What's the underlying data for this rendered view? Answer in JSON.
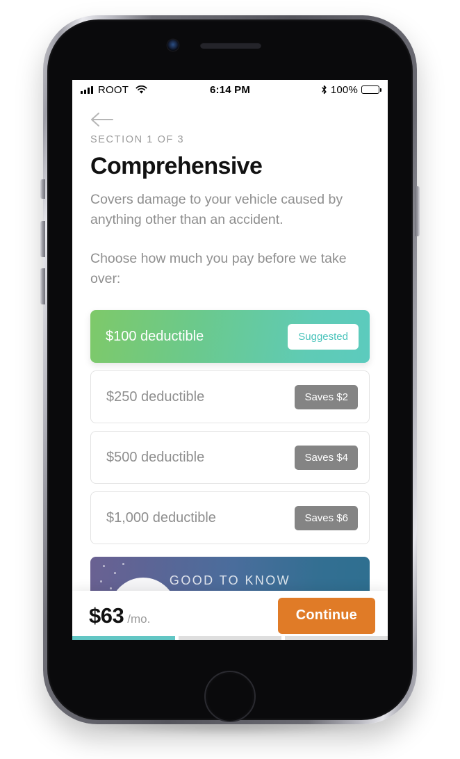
{
  "statusbar": {
    "carrier": "ROOT",
    "signal_icon": "cellular-signal-icon",
    "wifi_icon": "wifi-icon",
    "time": "6:14 PM",
    "bluetooth_icon": "bluetooth-icon",
    "battery_percent": "100%",
    "battery_icon": "battery-full-icon"
  },
  "nav": {
    "back_icon": "back-arrow-icon"
  },
  "header": {
    "eyebrow": "SECTION 1 OF 3",
    "title": "Comprehensive",
    "description": "Covers damage to your vehicle caused by anything other than an accident.",
    "prompt": "Choose how much you pay before we take over:"
  },
  "options": [
    {
      "label": "$100 deductible",
      "badge": "Suggested",
      "selected": true
    },
    {
      "label": "$250 deductible",
      "badge": "Saves $2",
      "selected": false
    },
    {
      "label": "$500 deductible",
      "badge": "Saves $4",
      "selected": false
    },
    {
      "label": "$1,000 deductible",
      "badge": "Saves $6",
      "selected": false
    }
  ],
  "good_to_know": {
    "label": "GOOD TO KNOW",
    "moon_icon": "moon-icon"
  },
  "bottombar": {
    "price_amount": "$63",
    "price_period": "/mo.",
    "continue_label": "Continue"
  },
  "progress": {
    "segments": 3,
    "active_index": 0
  },
  "colors": {
    "accent_orange": "#E07B27",
    "progress_teal": "#62C6C4",
    "selected_gradient_start": "#7EC969",
    "selected_gradient_end": "#5CCBBE",
    "badge_gray": "#848484",
    "suggested_text": "#49c3bb",
    "gtk_gradient_start": "#6a6192",
    "gtk_gradient_end": "#2e6f90"
  }
}
